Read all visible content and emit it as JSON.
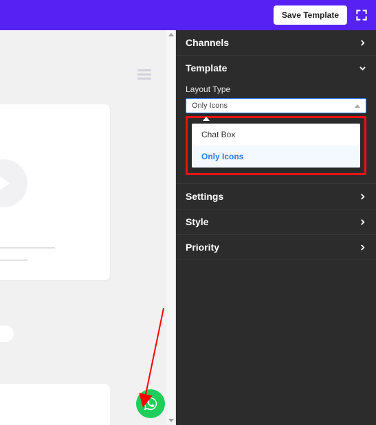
{
  "topbar": {
    "save_label": "Save Template"
  },
  "panel": {
    "channels": {
      "title": "Channels"
    },
    "template": {
      "title": "Template",
      "field_label": "Layout Type",
      "selected_value": "Only Icons",
      "options": [
        {
          "label": "Chat Box",
          "selected": false
        },
        {
          "label": "Only Icons",
          "selected": true
        }
      ]
    },
    "settings": {
      "title": "Settings"
    },
    "style": {
      "title": "Style"
    },
    "priority": {
      "title": "Priority"
    }
  },
  "colors": {
    "primary": "#5721f4",
    "highlight_border": "#e11",
    "whatsapp": "#1fcd5a",
    "accent": "#2b7aef"
  }
}
